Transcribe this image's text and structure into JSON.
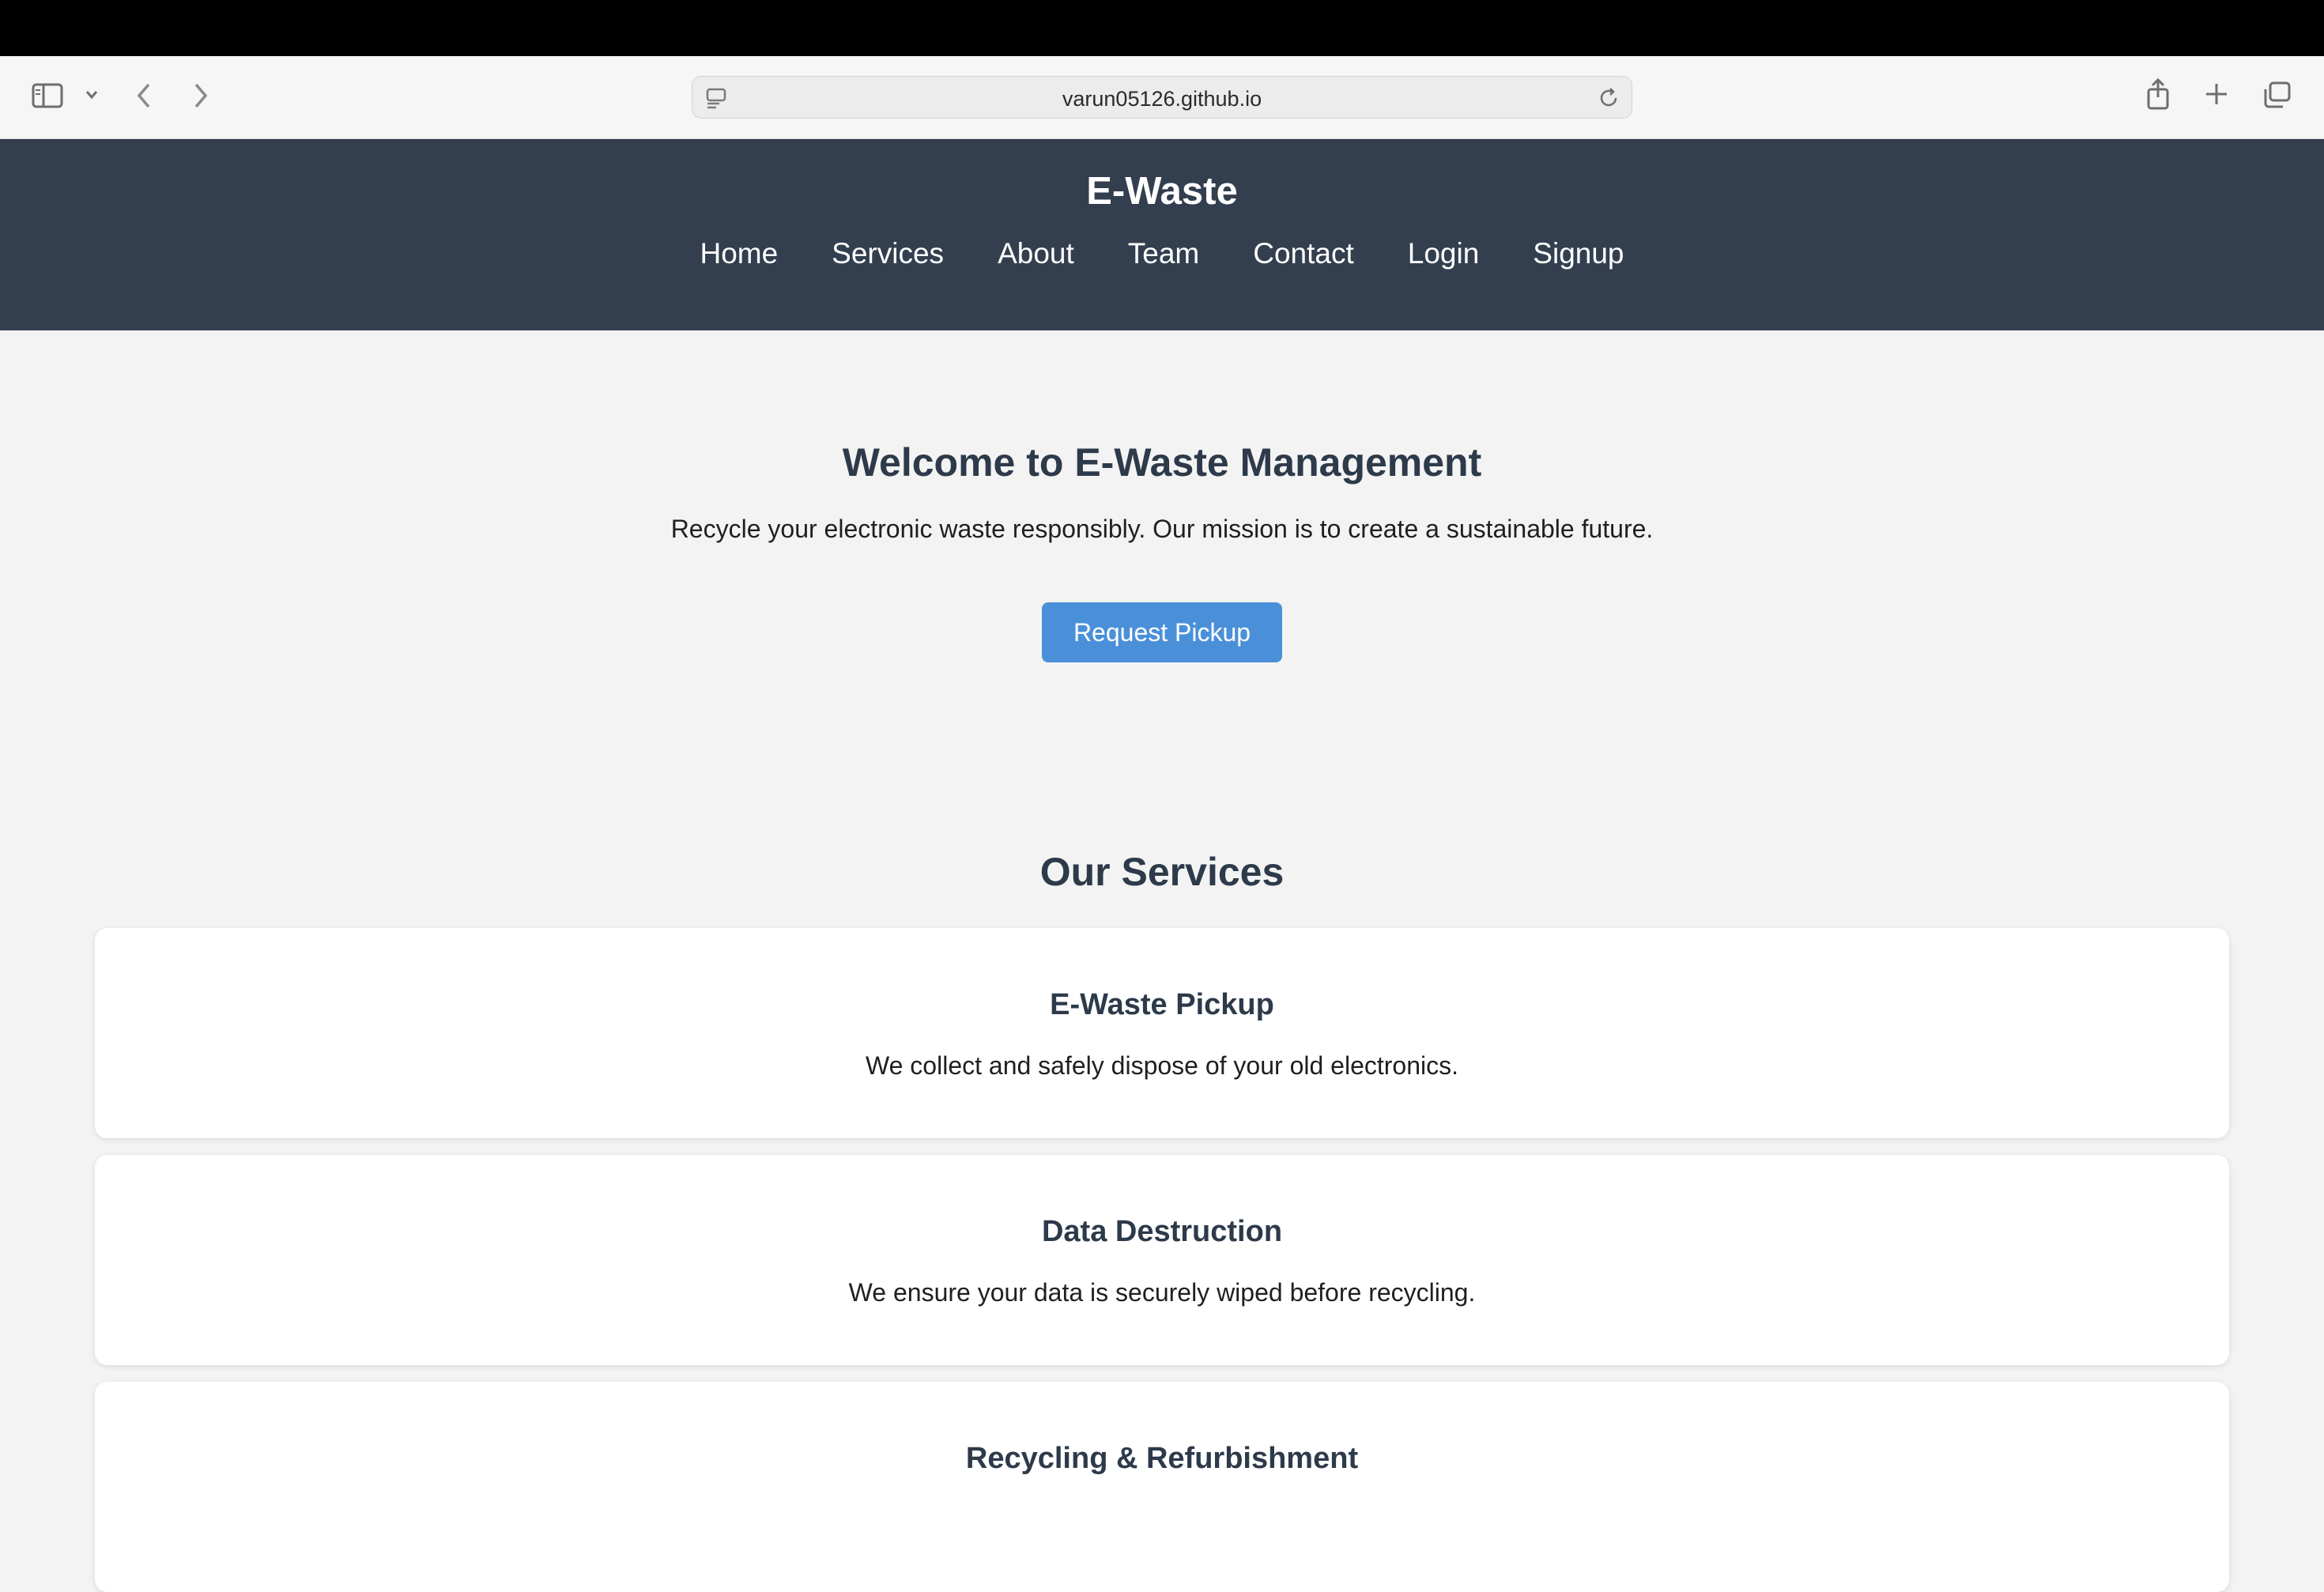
{
  "browser": {
    "url": "varun05126.github.io"
  },
  "site": {
    "title": "E-Waste",
    "nav": [
      "Home",
      "Services",
      "About",
      "Team",
      "Contact",
      "Login",
      "Signup"
    ]
  },
  "hero": {
    "title": "Welcome to E-Waste Management",
    "text": "Recycle your electronic waste responsibly. Our mission is to create a sustainable future.",
    "button_label": "Request Pickup"
  },
  "services": {
    "title": "Our Services",
    "cards": [
      {
        "title": "E-Waste Pickup",
        "description": "We collect and safely dispose of your old electronics."
      },
      {
        "title": "Data Destruction",
        "description": "We ensure your data is securely wiped before recycling."
      },
      {
        "title": "Recycling & Refurbishment",
        "description": ""
      }
    ]
  },
  "colors": {
    "header_bg": "#333f4f",
    "accent_button": "#4a90d9",
    "page_bg": "#f3f3f3"
  }
}
